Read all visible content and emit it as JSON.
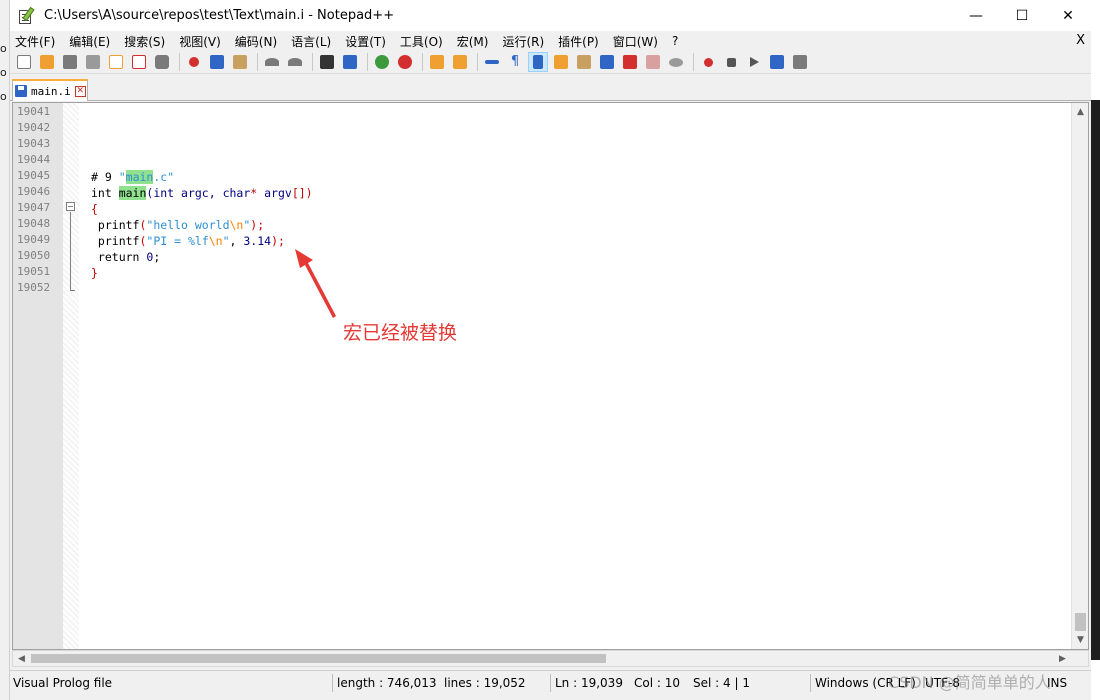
{
  "window": {
    "title": "C:\\Users\\A\\source\\repos\\test\\Text\\main.i - Notepad++",
    "controls": {
      "minimize": "—",
      "maximize": "☐",
      "close": "✕"
    }
  },
  "menu": {
    "items": [
      "文件(F)",
      "编辑(E)",
      "搜索(S)",
      "视图(V)",
      "编码(N)",
      "语言(L)",
      "设置(T)",
      "工具(O)",
      "宏(M)",
      "运行(R)",
      "插件(P)",
      "窗口(W)",
      "?"
    ],
    "close_label": "X"
  },
  "toolbar": {
    "icons": [
      "new-file-icon",
      "open-file-icon",
      "save-icon",
      "save-all-icon",
      "close-icon",
      "close-all-icon",
      "print-icon",
      "cut-icon",
      "copy-icon",
      "paste-icon",
      "undo-icon",
      "redo-icon",
      "find-icon",
      "replace-icon",
      "zoom-in-icon",
      "zoom-out-icon",
      "sync-vertical-icon",
      "sync-horizontal-icon",
      "word-wrap-icon",
      "show-all-chars-icon",
      "indent-guide-icon",
      "doc-map-icon",
      "function-list-icon",
      "folder-as-workspace-icon",
      "monitor-icon",
      "panel-icon",
      "eye-icon",
      "record-macro-icon",
      "stop-macro-icon",
      "play-macro-icon",
      "run-macro-multiple-icon",
      "save-macro-icon"
    ],
    "colors": {
      "blue": "#2f66c6",
      "gray": "#7a7a7a",
      "orange": "#f0a030",
      "red": "#d32f2f",
      "green": "#3c9a3c"
    }
  },
  "tab": {
    "label": "main.i",
    "close_label": "✕"
  },
  "editor": {
    "line_numbers": [
      "19041",
      "19042",
      "19043",
      "19044",
      "19045",
      "19046",
      "19047",
      "19048",
      "19049",
      "19050",
      "19051",
      "19052"
    ],
    "code": {
      "l19045": {
        "a": "# 9 ",
        "q1": "\"",
        "b": "main",
        "c": ".c\""
      },
      "l19046": {
        "a": "int ",
        "b": "main",
        "c": "(int argc, char",
        "d": "*",
        "e": " argv",
        "f": "[])"
      },
      "l19047": {
        "a": "{"
      },
      "l19048": {
        "a": " printf",
        "b": "(",
        "c": "\"hello world",
        "d": "\\n",
        "e": "\"",
        "f": ");"
      },
      "l19049": {
        "a": " printf",
        "b": "(",
        "c": "\"PI = %lf",
        "d": "\\n",
        "e": "\"",
        "f": ", ",
        "g": "3.14",
        "h": ");"
      },
      "l19050": {
        "a": " return ",
        "b": "0",
        "c": ";"
      },
      "l19051": {
        "a": "}"
      }
    }
  },
  "statusbar": {
    "language": "Visual Prolog file",
    "length": "length : 746,013",
    "lines": "lines : 19,052",
    "ln": "Ln : 19,039",
    "col": "Col : 10",
    "sel": "Sel : 4 | 1",
    "eol": "Windows (CR LF)",
    "encoding": "UTF-8",
    "ins": "INS"
  },
  "annotation": {
    "text": "宏已经被替换",
    "color": "#e53935"
  },
  "watermark": "CSDN @简简单单的人"
}
